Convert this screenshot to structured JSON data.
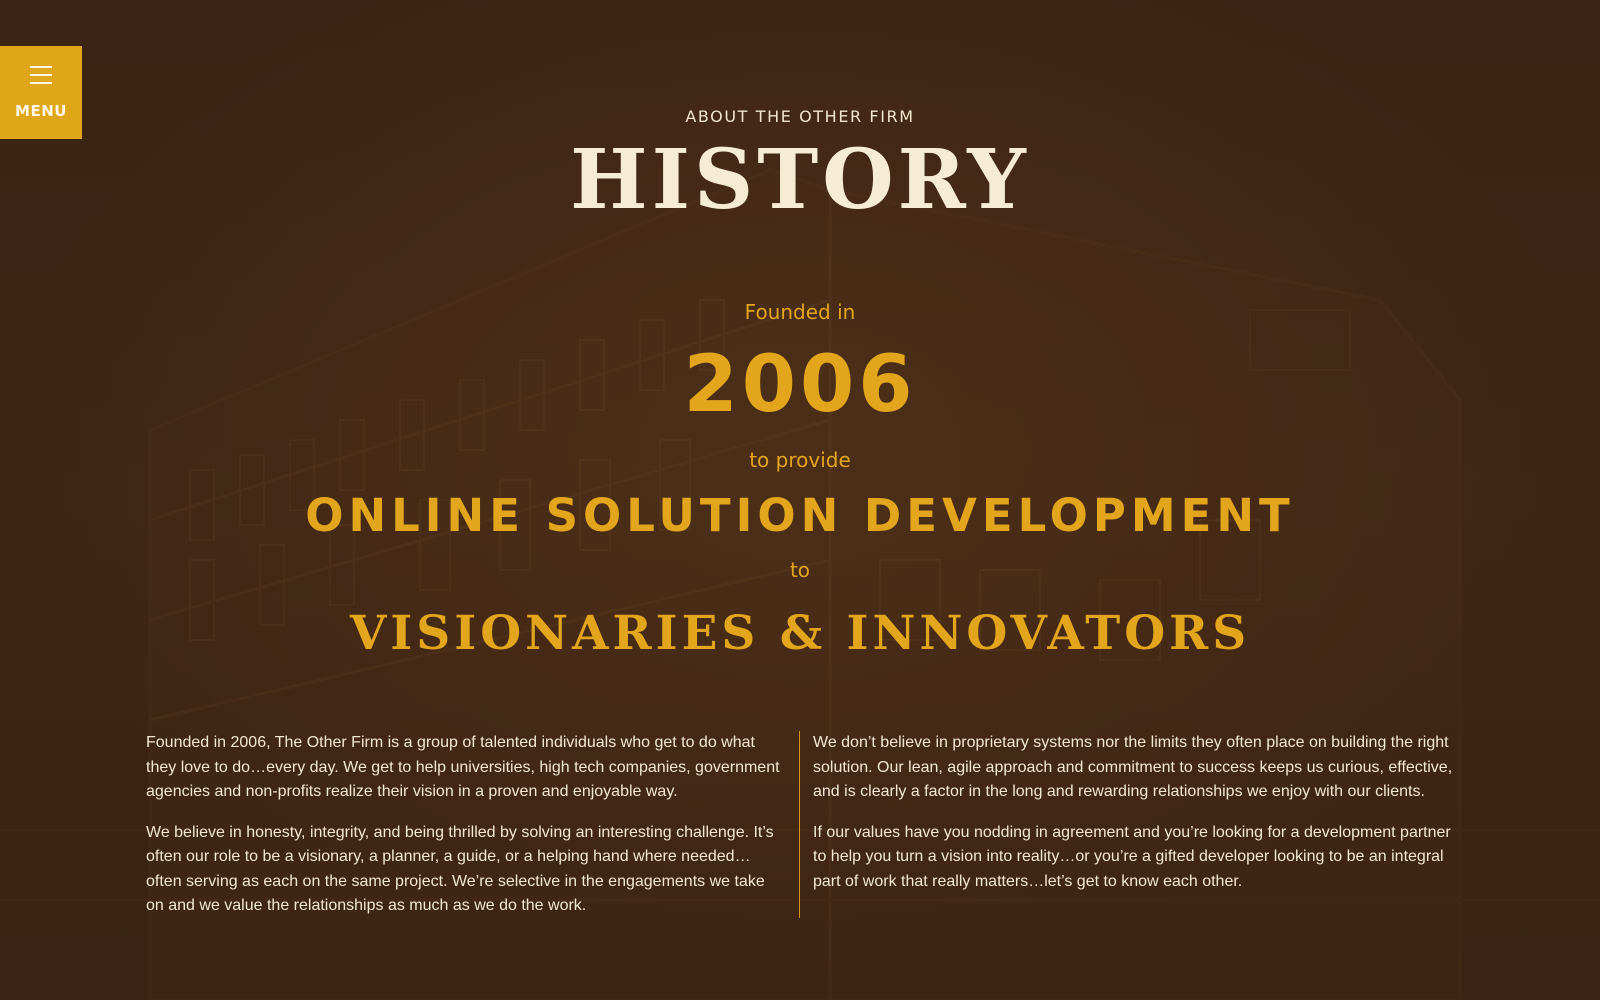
{
  "menu": {
    "label": "MENU",
    "icon": "hamburger-icon"
  },
  "hero": {
    "eyebrow": "ABOUT THE OTHER FIRM",
    "title": "HISTORY",
    "founded_in": "Founded in",
    "year": "2006",
    "to_provide": "to provide",
    "service": "ONLINE SOLUTION DEVELOPMENT",
    "to": "to",
    "audience": "VISIONARIES & INNOVATORS"
  },
  "content": {
    "left": [
      "Founded in 2006, The Other Firm is a group of talented individuals who get to do what they love to do…every day. We get to help universities, high tech companies, government agencies and non-profits realize their vision in a proven and enjoyable way.",
      "We believe in honesty, integrity, and being thrilled by solving an interesting challenge. It’s often our role to be a visionary, a planner, a guide, or a helping hand where needed… often serving as each on the same project. We’re selective in the engagements we take on and we value the relationships as much as we do the work."
    ],
    "right": [
      "We don’t believe in proprietary systems nor the limits they often place on building the right solution. Our lean, agile approach and commitment to success keeps us curious, effective, and is clearly a factor in the long and rewarding relationships we enjoy with our clients.",
      "If our values have you nodding in agreement and you’re looking for a development partner to help you turn a vision into reality…or you’re a gifted developer looking to be an integral part of work that really matters…let’s get to know each other."
    ]
  },
  "colors": {
    "background": "#3a2312",
    "accent": "#e3a51b",
    "title": "#f6ecd3",
    "body_text": "#f2e8d4"
  }
}
